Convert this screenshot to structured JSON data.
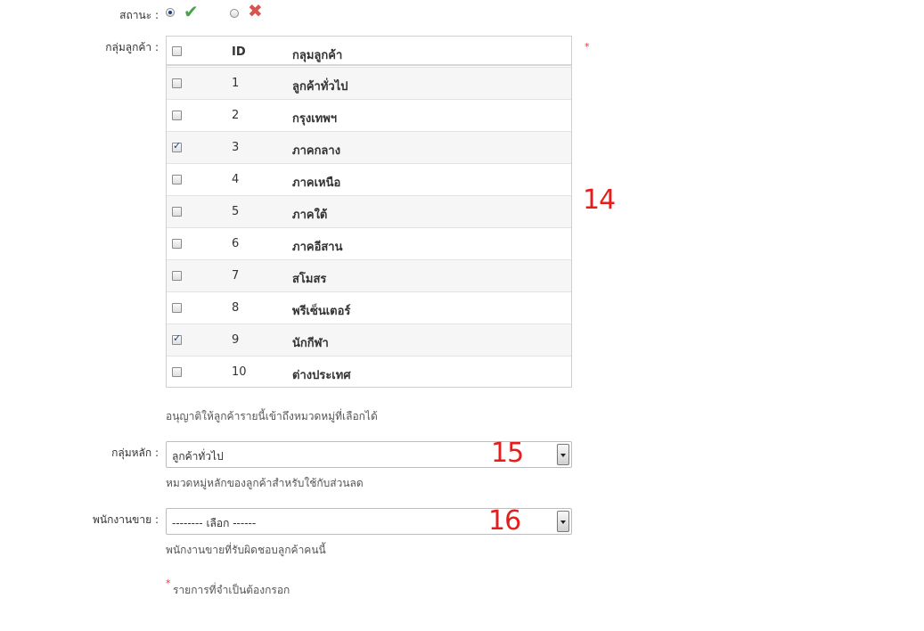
{
  "status": {
    "label": "สถานะ :",
    "active_icon": "check-icon",
    "inactive_icon": "cross-icon",
    "selected": "active"
  },
  "customer_group": {
    "label": "กลุ่มลูกค้า :",
    "required_mark": "*",
    "columns": {
      "id": "ID",
      "name": "กลุมลูกค้า"
    },
    "rows": [
      {
        "id": "1",
        "name": "ลูกค้าทั่วไป",
        "checked": false
      },
      {
        "id": "2",
        "name": "กรุงเทพฯ",
        "checked": false
      },
      {
        "id": "3",
        "name": "ภาคกลาง",
        "checked": true
      },
      {
        "id": "4",
        "name": "ภาคเหนือ",
        "checked": false
      },
      {
        "id": "5",
        "name": "ภาคใต้",
        "checked": false
      },
      {
        "id": "6",
        "name": "ภาคอีสาน",
        "checked": false
      },
      {
        "id": "7",
        "name": "สโมสร",
        "checked": false
      },
      {
        "id": "8",
        "name": "พรีเซ็นเตอร์",
        "checked": false
      },
      {
        "id": "9",
        "name": "นักกีฬา",
        "checked": true
      },
      {
        "id": "10",
        "name": "ต่างประเทศ",
        "checked": false
      }
    ],
    "help": "อนุญาติให้ลูกค้ารายนี้เข้าถึงหมวดหมู่ที่เลือกได้",
    "annotation": "14"
  },
  "main_group": {
    "label": "กลุ่มหลัก :",
    "value": "ลูกค้าทั่วไป",
    "help": "หมวดหมู่หลักของลูกค้าสำหรับใช้กับส่วนลด",
    "annotation": "15"
  },
  "sales_staff": {
    "label": "พนักงานขาย :",
    "value": "-------- เลือก ------",
    "help": "พนักงานขายที่รับผิดชอบลูกค้าคนนี้",
    "annotation": "16"
  },
  "footer": {
    "required_mark": "*",
    "required_note": "รายการที่จำเป็นต้องกรอก"
  },
  "colors": {
    "annotation": "#e61d1d",
    "check": "#47a447",
    "cross": "#d9534f",
    "required": "#ee3333"
  }
}
